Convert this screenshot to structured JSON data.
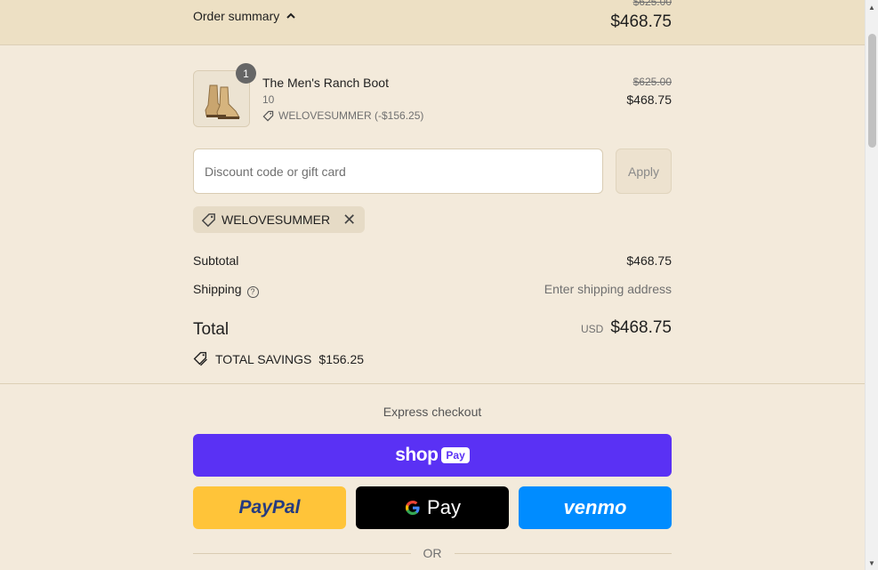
{
  "header": {
    "order_summary_label": "Order summary",
    "toggle_icon": "chevron-up-icon",
    "original_total": "$625.00",
    "total": "$468.75"
  },
  "product": {
    "name": "The Men's Ranch Boot",
    "variant": "10",
    "quantity": "1",
    "discount_code": "WELOVESUMMER (-$156.25)",
    "original_price": "$625.00",
    "price": "$468.75"
  },
  "discount": {
    "placeholder": "Discount code or gift card",
    "value": "",
    "apply_label": "Apply",
    "applied_code": "WELOVESUMMER"
  },
  "totals": {
    "subtotal_label": "Subtotal",
    "subtotal": "$468.75",
    "shipping_label": "Shipping",
    "shipping_value": "Enter shipping address",
    "total_label": "Total",
    "currency": "USD",
    "total": "$468.75",
    "savings_label": "TOTAL SAVINGS",
    "savings": "$156.25"
  },
  "express": {
    "label": "Express checkout",
    "shop_word": "shop",
    "shop_badge": "Pay",
    "paypal_label": "PayPal",
    "gpay_label": "Pay",
    "venmo_label": "venmo",
    "or_label": "OR"
  },
  "colors": {
    "background": "#f3eadb",
    "header_bg": "#ede0c4",
    "shop_pay": "#5a31f4",
    "paypal": "#ffc439",
    "google_pay": "#000000",
    "venmo": "#008cff"
  }
}
